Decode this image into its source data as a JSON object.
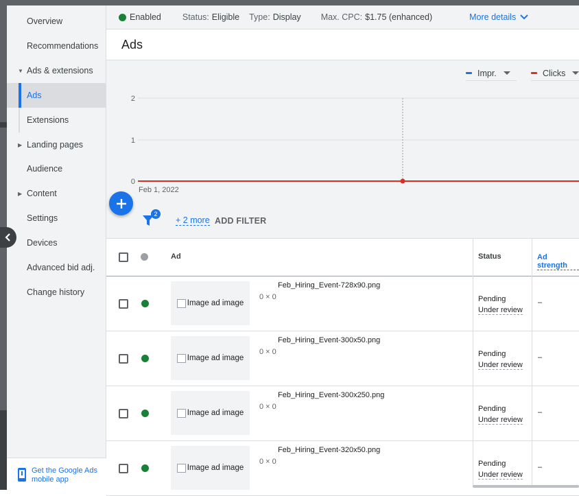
{
  "status_bar": {
    "enabled_label": "Enabled",
    "status_label": "Status:",
    "status_value": "Eligible",
    "type_label": "Type:",
    "type_value": "Display",
    "cpc_label": "Max. CPC:",
    "cpc_value": "$1.75 (enhanced)",
    "more_details": "More details"
  },
  "page_title": "Ads",
  "sidebar": {
    "items": [
      {
        "label": "Overview"
      },
      {
        "label": "Recommendations"
      },
      {
        "label": "Ads & extensions"
      },
      {
        "label": "Ads"
      },
      {
        "label": "Extensions"
      },
      {
        "label": "Landing pages"
      },
      {
        "label": "Audience"
      },
      {
        "label": "Content"
      },
      {
        "label": "Settings"
      },
      {
        "label": "Devices"
      },
      {
        "label": "Advanced bid adj."
      },
      {
        "label": "Change history"
      }
    ],
    "mobile_app_link": "Get the Google Ads mobile app"
  },
  "chart": {
    "metrics": [
      {
        "label": "Impr.",
        "color": "#1a73e8"
      },
      {
        "label": "Clicks",
        "color": "#d93025"
      }
    ],
    "y_ticks": [
      "2",
      "1",
      "0"
    ],
    "x_start_label": "Feb 1, 2022"
  },
  "filters": {
    "badge_count": "2",
    "more_link": "+ 2 more",
    "add_filter": "ADD FILTER"
  },
  "table": {
    "headers": {
      "ad": "Ad",
      "status": "Status",
      "ad_strength": "Ad strength"
    },
    "rows": [
      {
        "image_alt": "Image ad image",
        "file_name": "Feb_Hiring_Event-728x90.png",
        "dims": "0 × 0",
        "status_line1": "Pending",
        "status_line2": "Under review",
        "ad_strength": "–"
      },
      {
        "image_alt": "Image ad image",
        "file_name": "Feb_Hiring_Event-300x50.png",
        "dims": "0 × 0",
        "status_line1": "Pending",
        "status_line2": "Under review",
        "ad_strength": "–"
      },
      {
        "image_alt": "Image ad image",
        "file_name": "Feb_Hiring_Event-300x250.png",
        "dims": "0 × 0",
        "status_line1": "Pending",
        "status_line2": "Under review",
        "ad_strength": "–"
      },
      {
        "image_alt": "Image ad image",
        "file_name": "Feb_Hiring_Event-320x50.png",
        "dims": "0 × 0",
        "status_line1": "Pending",
        "status_line2": "Under review",
        "ad_strength": "–"
      }
    ]
  },
  "colors": {
    "accent": "#1a73e8",
    "enabled_green": "#188038",
    "clicks_red": "#d93025"
  }
}
